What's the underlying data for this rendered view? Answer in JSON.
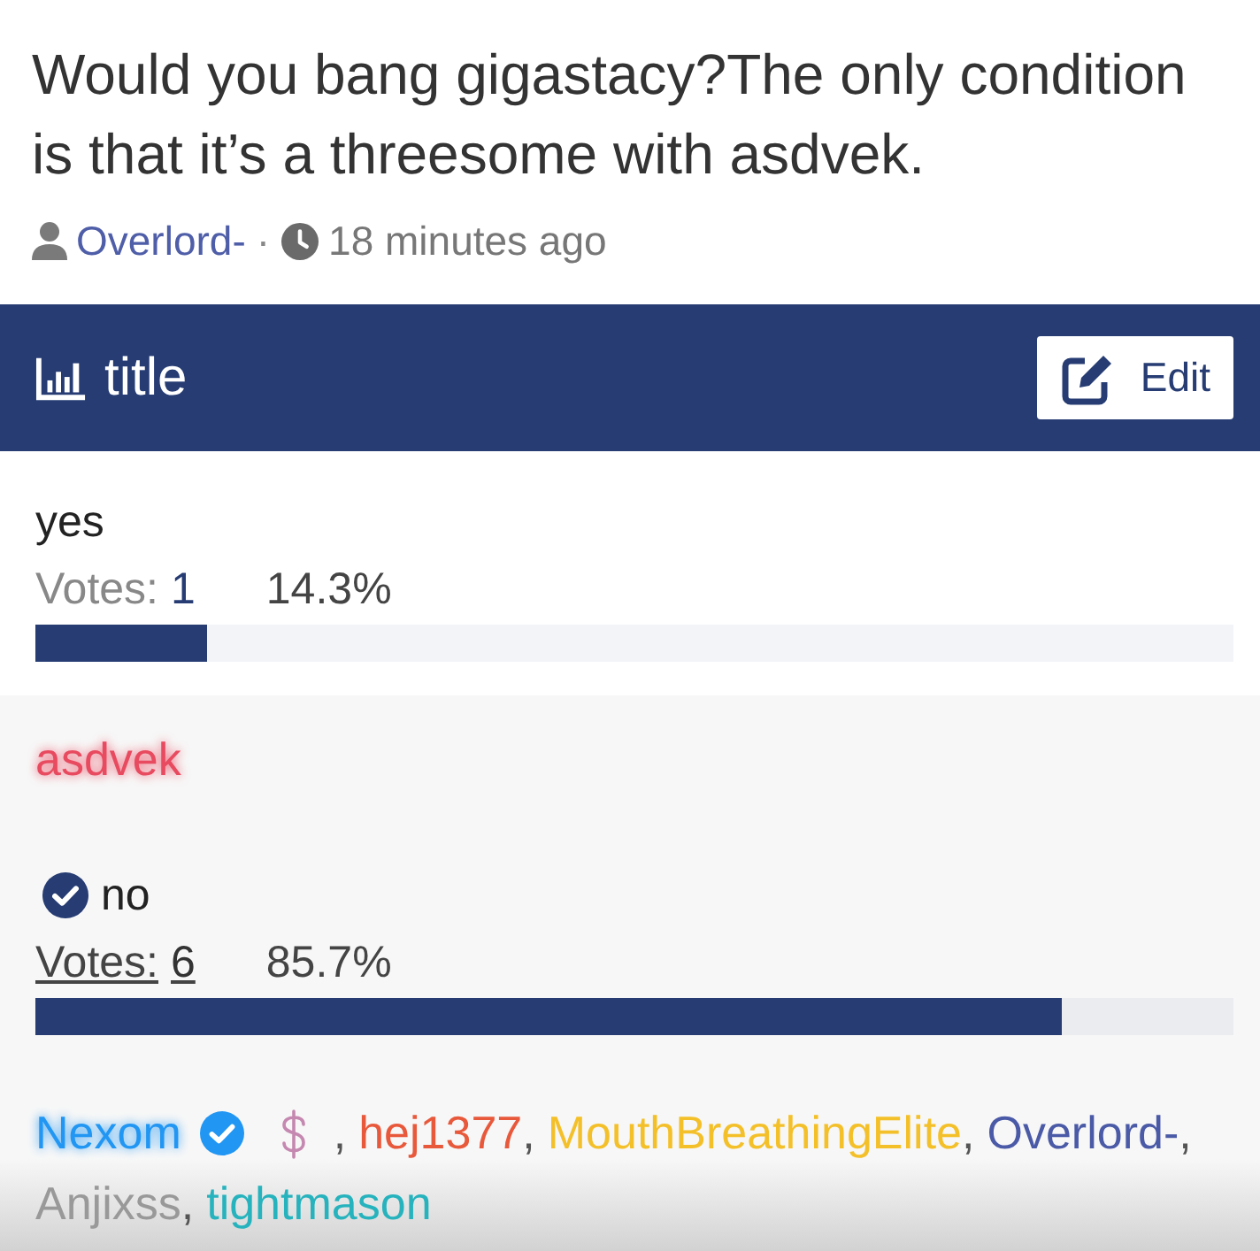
{
  "question": {
    "text": "Would you bang gigastacy?The only condition is that it’s a threesome with asdvek.",
    "author": "Overlord-",
    "separator": "·",
    "time": "18 minutes ago"
  },
  "poll_header": {
    "title": "title",
    "edit_button": "Edit"
  },
  "voter_separator": ",",
  "options": [
    {
      "label": "yes",
      "selected": false,
      "votes_label": "Votes:",
      "votes": "1",
      "votes_hovered": false,
      "percent": "14.3%",
      "level": 0.143,
      "voters": [
        {
          "name": "asdvek",
          "color": "#e84a5f",
          "glow": true,
          "verified": false,
          "donor": false
        }
      ]
    },
    {
      "label": "no",
      "selected": true,
      "votes_label": "Votes:",
      "votes": "6",
      "votes_hovered": true,
      "percent": "85.7%",
      "level": 0.857,
      "voters": [
        {
          "name": "Nexom",
          "color": "#2196f3",
          "glow": true,
          "verified": true,
          "donor": true
        },
        {
          "name": "hej1377",
          "color": "#e8593c",
          "glow": false,
          "verified": false,
          "donor": false
        },
        {
          "name": "MouthBreathingElite",
          "color": "#f4c02a",
          "glow": false,
          "verified": false,
          "donor": false
        },
        {
          "name": "Overlord-",
          "color": "#4b5aa7",
          "glow": false,
          "verified": false,
          "donor": false
        },
        {
          "name": "Anjixss",
          "color": "#999999",
          "glow": false,
          "verified": false,
          "donor": false
        },
        {
          "name": "tightmason",
          "color": "#26b3bd",
          "glow": false,
          "verified": false,
          "donor": false
        }
      ]
    }
  ]
}
